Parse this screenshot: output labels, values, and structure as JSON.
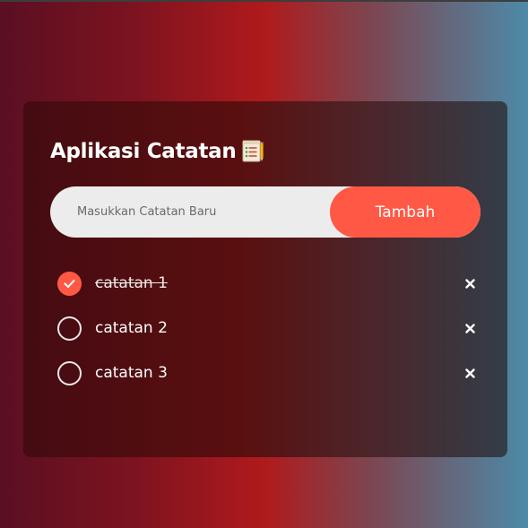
{
  "app": {
    "title": "Aplikasi Catatan",
    "title_icon": "notepad-checklist-icon"
  },
  "input": {
    "placeholder": "Masukkan Catatan Baru",
    "value": ""
  },
  "add_button": {
    "label": "Tambah"
  },
  "todos": [
    {
      "text": "catatan 1",
      "checked": true,
      "delete_icon": "close-icon"
    },
    {
      "text": "catatan 2",
      "checked": false,
      "delete_icon": "close-icon"
    },
    {
      "text": "catatan 3",
      "checked": false,
      "delete_icon": "close-icon"
    }
  ],
  "colors": {
    "accent": "#ff5945",
    "input_bg": "#ececec",
    "text": "#ffffff"
  }
}
